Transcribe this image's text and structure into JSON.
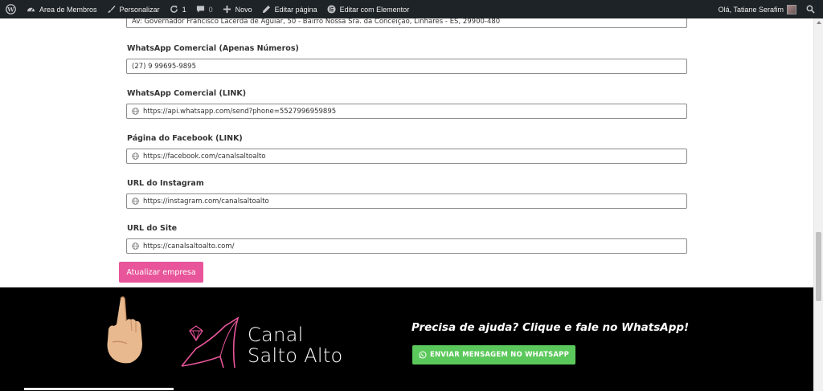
{
  "adminbar": {
    "site_label": "Area de Membros",
    "customize_label": "Personalizar",
    "updates_count": "1",
    "comments_count": "0",
    "new_label": "Novo",
    "edit_page_label": "Editar página",
    "elementor_label": "Editar com Elementor",
    "greeting": "Olá, Tatiane Serafim"
  },
  "form": {
    "address_value": "Av: Governador Francisco Lacerda de Aguiar, 50 - Bairro Nossa Sra. da Conceição, Linhares - ES, 29900-480",
    "whatsapp_label": "WhatsApp Comercial (Apenas Números)",
    "whatsapp_value": "(27) 9 99695-9895",
    "whatsapp_link_label": "WhatsApp Comercial (LINK)",
    "whatsapp_link_value": "https://api.whatsapp.com/send?phone=5527996959895",
    "facebook_label": "Página do Facebook (LINK)",
    "facebook_value": "https://facebook.com/canalsaltoalto",
    "instagram_label": "URL do Instagram",
    "instagram_value": "https://instagram.com/canalsaltoalto",
    "site_label": "URL do Site",
    "site_value": "https://canalsaltoalto.com/",
    "submit_label": "Atualizar empresa"
  },
  "footer": {
    "logo_line1": "Canal",
    "logo_line2": "Salto Alto",
    "help_text": "Precisa de ajuda? Clique e fale no WhatsApp!",
    "whatsapp_button": "ENVIAR MENSAGEM NO WHATSAPP"
  },
  "colors": {
    "adminbar_bg": "#1d2327",
    "submit_bg": "#e8559a",
    "footer_bg": "#000000",
    "whatsapp_bg": "#5bc85b",
    "logo_accent": "#e8559a"
  },
  "icons": {
    "wordpress": "wordpress-icon",
    "home": "dashboard-icon",
    "customize": "brush-icon",
    "updates": "refresh-icon",
    "comments": "comment-icon",
    "new": "plus-icon",
    "edit": "pencil-icon",
    "elementor": "elementor-icon",
    "search": "search-icon",
    "globe": "globe-icon",
    "whatsapp": "whatsapp-icon"
  }
}
